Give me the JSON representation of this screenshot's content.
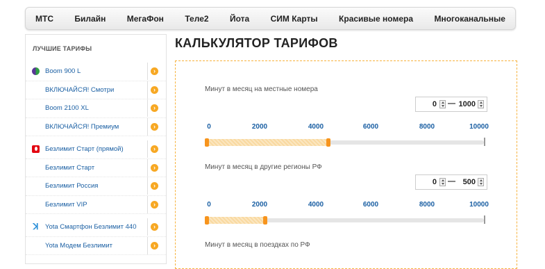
{
  "topnav": {
    "items": [
      "МТС",
      "Билайн",
      "МегаФон",
      "Теле2",
      "Йота",
      "СИМ Карты",
      "Красивые номера",
      "Многоканальные"
    ]
  },
  "sidebar": {
    "title": "ЛУЧШИЕ ТАРИФЫ",
    "groups": [
      {
        "brand": "megafon-logo",
        "items": [
          "Boom 900 L",
          "ВКЛЮЧАЙСЯ! Смотри",
          "Boom 2100 XL",
          "ВКЛЮЧАЙСЯ! Премиум"
        ]
      },
      {
        "brand": "mts-logo",
        "items": [
          "Безлимит Старт (прямой)",
          "Безлимит Старт",
          "Безлимит Россия",
          "Безлимит VIP"
        ]
      },
      {
        "brand": "yota-logo",
        "items": [
          "Yota Смартфон Безлимит 440",
          "Yota Модем Безлимит"
        ]
      }
    ]
  },
  "page": {
    "title": "КАЛЬКУЛЯТОР ТАРИФОВ"
  },
  "calculator": {
    "accent_color": "#f7941d",
    "tick_labels": [
      "0",
      "2000",
      "4000",
      "6000",
      "8000",
      "10000"
    ],
    "sections": [
      {
        "label": "Минут в месяц на местные номера",
        "from": "0",
        "to": "1000",
        "dash": "—",
        "range_max": 10000,
        "fill_fraction": 0.1
      },
      {
        "label": "Минут в месяц в другие регионы РФ",
        "from": "0",
        "to": "500",
        "dash": "—",
        "range_max": 10000,
        "fill_fraction": 0.05
      },
      {
        "label": "Минут в месяц в поездках по РФ"
      }
    ]
  }
}
